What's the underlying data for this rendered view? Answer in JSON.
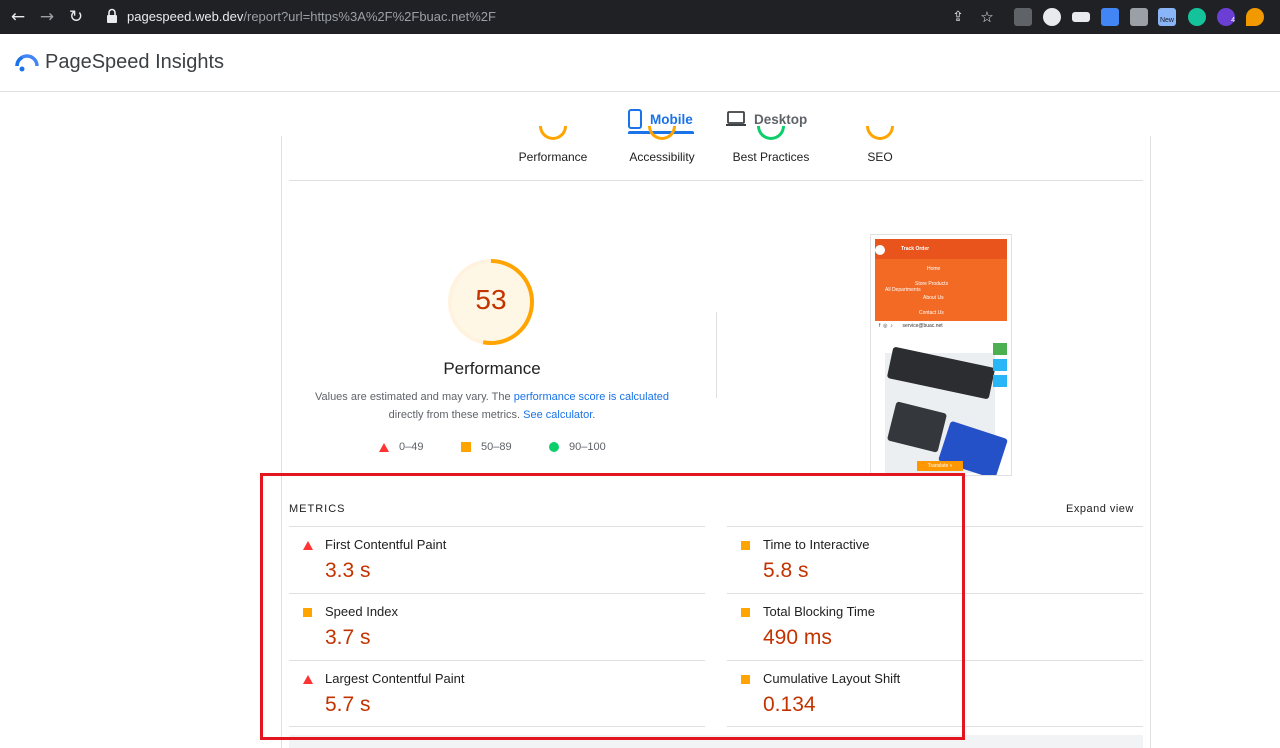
{
  "browser": {
    "url_host": "pagespeed.web.dev",
    "url_path": "/report?url=https%3A%2F%2Fbuac.net%2F",
    "ext_badge_new": "New",
    "ext_badge_count": "4"
  },
  "app": {
    "title": "PageSpeed Insights"
  },
  "tabs": {
    "mobile": "Mobile",
    "desktop": "Desktop"
  },
  "categories": [
    "Performance",
    "Accessibility",
    "Best Practices",
    "SEO"
  ],
  "performance": {
    "score": "53",
    "score_fraction": 0.53,
    "title": "Performance",
    "note_pre": "Values are estimated and may vary. The ",
    "note_link1": "performance score is calculated",
    "note_mid": " directly from these metrics. ",
    "note_link2": "See calculator",
    "note_end": "."
  },
  "legend": {
    "fail": "0–49",
    "average": "50–89",
    "pass": "90–100"
  },
  "thumbnail": {
    "track_order": "Track Order",
    "home": "Home",
    "store_products": "Store Products",
    "all_departments": "All Departments",
    "about_us": "About Us",
    "contact_us": "Contact Us",
    "email": "service@buac.net",
    "translate": "Translate »"
  },
  "metrics": {
    "section_label": "METRICS",
    "expand_label": "Expand view",
    "fcp": {
      "name": "First Contentful Paint",
      "value": "3.3 s"
    },
    "si": {
      "name": "Speed Index",
      "value": "3.7 s"
    },
    "lcp": {
      "name": "Largest Contentful Paint",
      "value": "5.7 s"
    },
    "tti": {
      "name": "Time to Interactive",
      "value": "5.8 s"
    },
    "tbt": {
      "name": "Total Blocking Time",
      "value": "490 ms"
    },
    "cls": {
      "name": "Cumulative Layout Shift",
      "value": "0.134"
    }
  },
  "colors": {
    "accent": "#1a73e8",
    "fail": "#ff3333",
    "average": "#ffa400",
    "pass": "#0cce6b",
    "fail_text": "#c33300",
    "highlight": "#e3161f"
  }
}
